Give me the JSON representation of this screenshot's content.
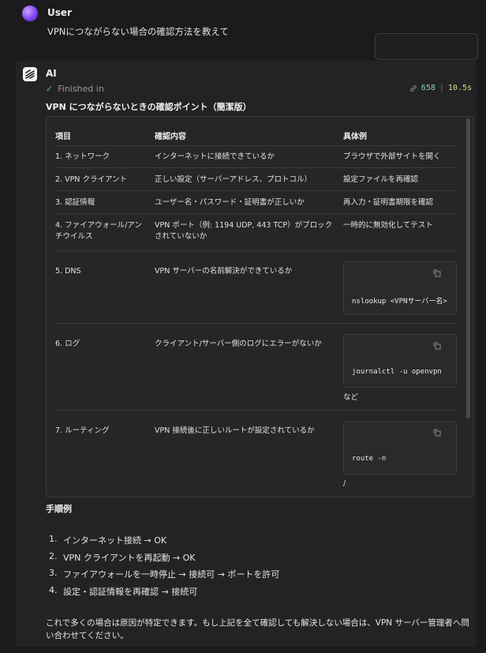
{
  "user": {
    "name": "User",
    "message": "VPNにつながらない場合の確認方法を教えて"
  },
  "ai": {
    "name": "AI",
    "status": "Finished in",
    "tokens": "658",
    "sep": "|",
    "time": "10.5s"
  },
  "heading": "VPN につながらないときの確認ポイント（簡潔版）",
  "table": {
    "headers": [
      "項目",
      "確認内容",
      "具体例"
    ],
    "rows": [
      {
        "item": "1. ネットワーク",
        "check": "インターネットに接続できているか",
        "example": "ブラウザで外部サイトを開く"
      },
      {
        "item": "2. VPN クライアント",
        "check": "正しい設定（サーバーアドレス、プロトコル）",
        "example": "設定ファイルを再確認"
      },
      {
        "item": "3. 認証情報",
        "check": "ユーザー名・パスワード・証明書が正しいか",
        "example": "再入力・証明書期限を確認"
      },
      {
        "item": "4. ファイアウォール/アンチウイルス",
        "check": "VPN ポート（例: 1194 UDP, 443 TCP）がブロックされていないか",
        "example": "一時的に無効化してテスト"
      },
      {
        "item": "5. DNS",
        "check": "VPN サーバーの名前解決ができているか",
        "code": "nslookup <VPNサーバー名>",
        "after": ""
      },
      {
        "item": "6. ログ",
        "check": "クライアント/サーバー側のログにエラーがないか",
        "code": "journalctl -u openvpn",
        "after": "など"
      },
      {
        "item": "7. ルーティング",
        "check": "VPN 接続後に正しいルートが設定されているか",
        "code": "route -n",
        "after": "/"
      }
    ]
  },
  "procedure": {
    "title": "手順例",
    "steps": [
      {
        "num": "1.",
        "text": "インターネット接続 → OK"
      },
      {
        "num": "2.",
        "text": "VPN クライアントを再起動 → OK"
      },
      {
        "num": "3.",
        "text": "ファイアウォールを一時停止 → 接続可 → ポートを許可"
      },
      {
        "num": "4.",
        "text": "設定・認証情報を再確認 → 接続可"
      }
    ]
  },
  "footer": "これで多くの場合は原因が特定できます。もし上記を全て確認しても解決しない場合は、VPN サーバー管理者へ問い合わせてください。"
}
